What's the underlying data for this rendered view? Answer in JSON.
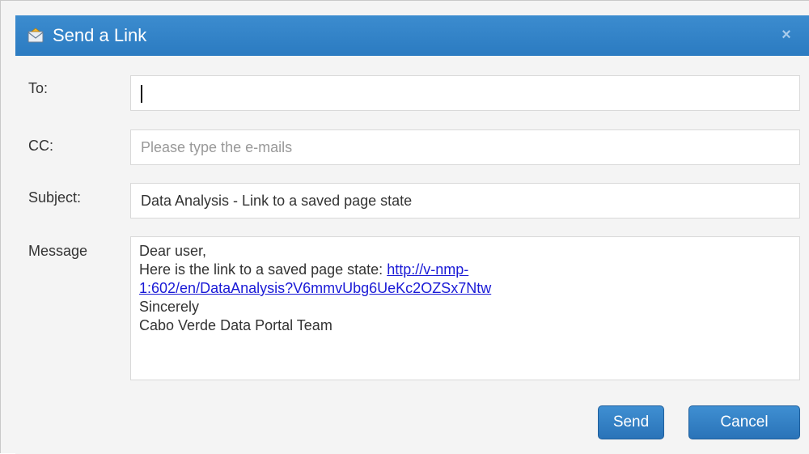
{
  "dialog": {
    "title": "Send a Link",
    "close_symbol": "×"
  },
  "icons": {
    "title_icon": "mail-icon",
    "close_icon": "close-icon"
  },
  "form": {
    "to": {
      "label": "To:",
      "value": ""
    },
    "cc": {
      "label": "CC:",
      "value": "",
      "placeholder": "Please type the e-mails"
    },
    "subject": {
      "label": "Subject:",
      "value": "Data Analysis - Link to a saved page state"
    },
    "message": {
      "label": "Message",
      "greeting": "Dear user,",
      "intro": "Here is the link to a saved page state: ",
      "link_line1": "http://v-nmp-",
      "link_line2": "1:602/en/DataAnalysis?V6mmvUbg6UeKc2OZSx7Ntw",
      "signoff": "Sincerely",
      "signature": "Cabo Verde Data Portal Team"
    }
  },
  "buttons": {
    "send": "Send",
    "cancel": "Cancel"
  },
  "colors": {
    "titlebar": "#2f80c6",
    "button": "#3181c6",
    "link": "#1a1ad6"
  }
}
